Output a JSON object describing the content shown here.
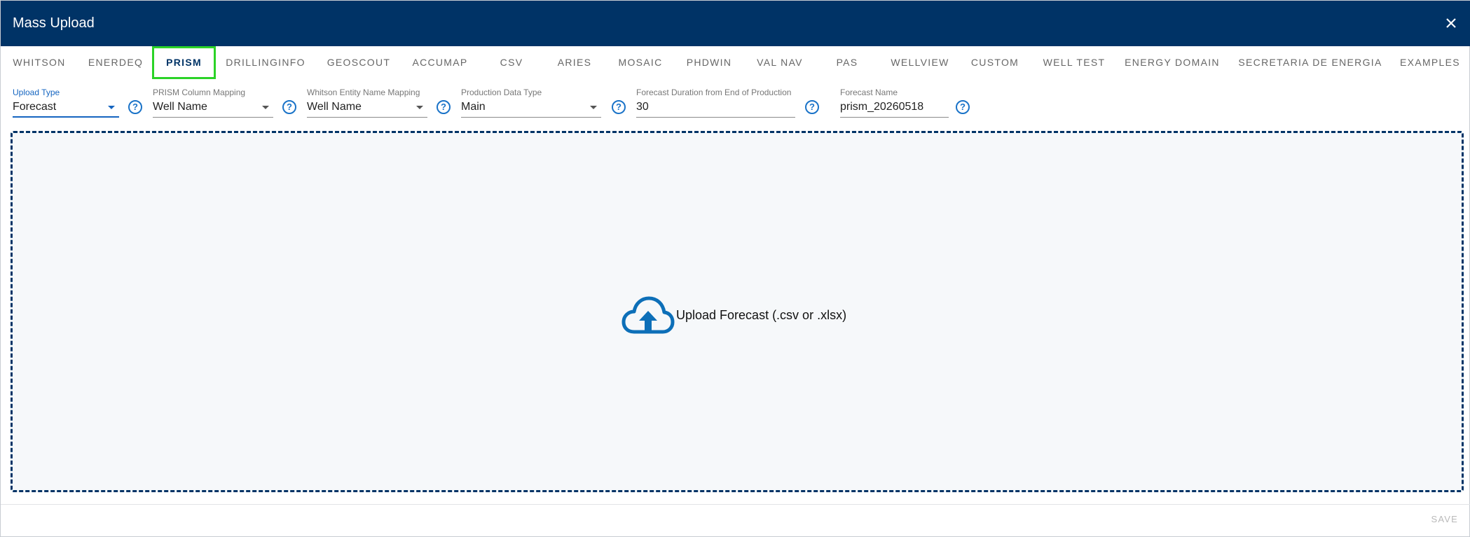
{
  "dialog": {
    "title": "Mass Upload"
  },
  "tabs": [
    {
      "label": "WHITSON"
    },
    {
      "label": "ENERDEQ"
    },
    {
      "label": "PRISM"
    },
    {
      "label": "DRILLINGINFO"
    },
    {
      "label": "GEOSCOUT"
    },
    {
      "label": "ACCUMAP"
    },
    {
      "label": "CSV"
    },
    {
      "label": "ARIES"
    },
    {
      "label": "MOSAIC"
    },
    {
      "label": "PHDWIN"
    },
    {
      "label": "VAL NAV"
    },
    {
      "label": "PAS"
    },
    {
      "label": "WELLVIEW"
    },
    {
      "label": "CUSTOM"
    },
    {
      "label": "WELL TEST"
    },
    {
      "label": "ENERGY DOMAIN"
    },
    {
      "label": "SECRETARIA DE ENERGIA"
    },
    {
      "label": "EXAMPLES"
    }
  ],
  "form": {
    "upload_type": {
      "label": "Upload Type",
      "value": "Forecast"
    },
    "prism_column_mapping": {
      "label": "PRISM Column Mapping",
      "value": "Well Name"
    },
    "entity_name_mapping": {
      "label": "Whitson Entity Name Mapping",
      "value": "Well Name"
    },
    "production_data_type": {
      "label": "Production Data Type",
      "value": "Main"
    },
    "forecast_duration": {
      "label": "Forecast Duration from End of Production",
      "value": "30"
    },
    "forecast_name": {
      "label": "Forecast Name",
      "value": "prism_20260518"
    }
  },
  "help_icon_glyph": "?",
  "dropzone": {
    "text": "Upload Forecast (.csv or .xlsx)",
    "icon": "cloud-upload-icon"
  },
  "footer": {
    "save_label": "SAVE"
  },
  "colors": {
    "header_bg": "#003366",
    "accent": "#1a73c8",
    "active_tab_outline": "#2bd327"
  }
}
